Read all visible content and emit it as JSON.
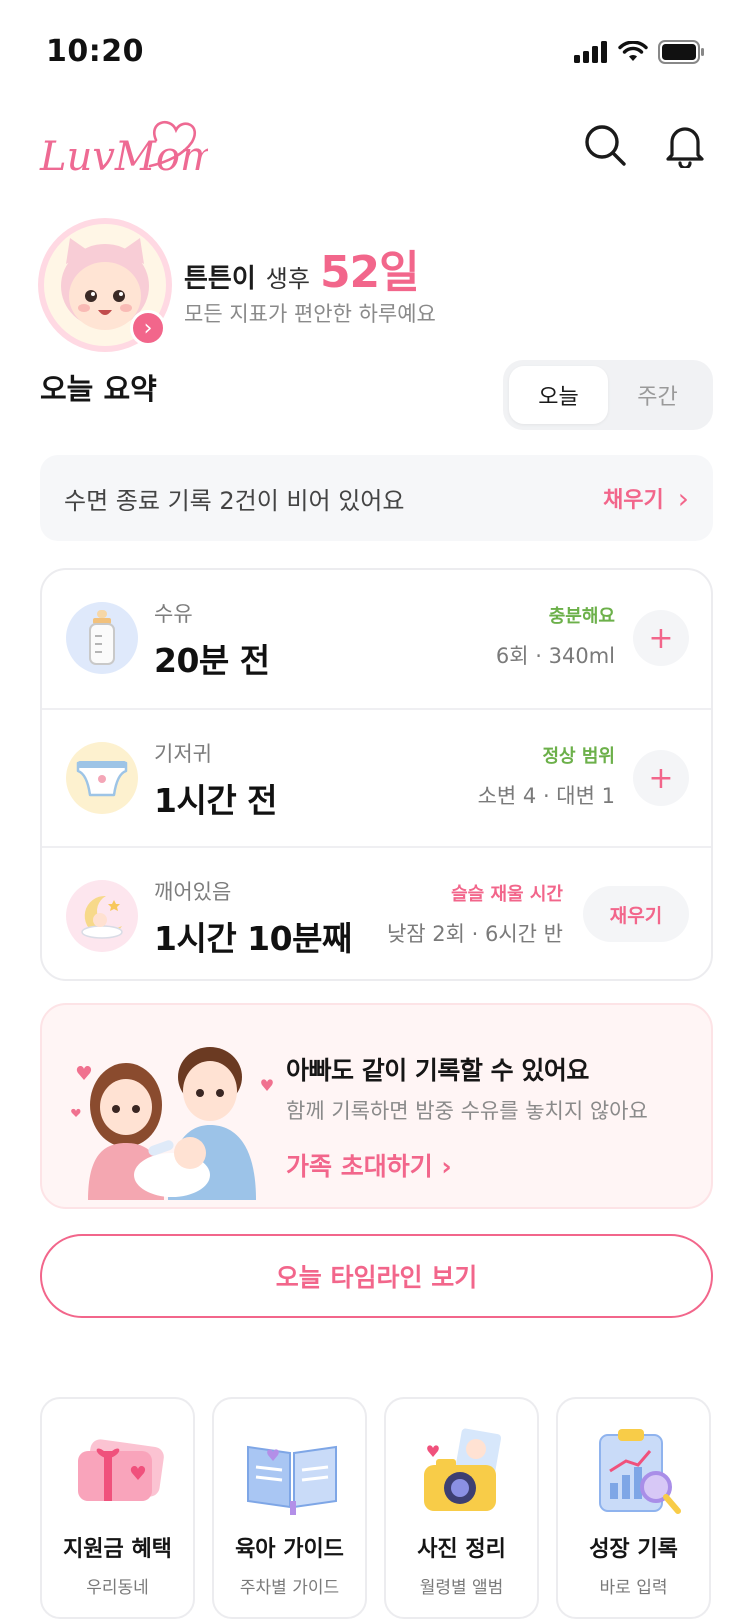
{
  "status_bar": {
    "time": "10:20"
  },
  "header": {
    "logo_text": "LuvMom"
  },
  "profile": {
    "baby_name": "튼튼이",
    "age_prefix": "생후",
    "age_days": "52일",
    "status_message": "모든 지표가 편안한 하루예요"
  },
  "summary": {
    "title": "오늘 요약",
    "tabs": [
      {
        "label": "오늘",
        "selected": true
      },
      {
        "label": "주간",
        "selected": false
      }
    ]
  },
  "alert": {
    "message": "수면 종료 기록 2건이 비어 있어요",
    "action_label": "채우기",
    "action_arrow": "›"
  },
  "records": [
    {
      "label": "수유",
      "value": "20분 전",
      "status": "충분해요",
      "detail": "6회 · 340ml",
      "button": "+",
      "icon": "baby-bottle-icon"
    },
    {
      "label": "기저귀",
      "value": "1시간 전",
      "status": "정상 범위",
      "detail": "소변 4 · 대변 1",
      "button": "+",
      "icon": "diaper-icon"
    },
    {
      "label": "깨어있음",
      "value": "1시간 10분째",
      "status": "슬슬 재울 시간",
      "detail": "낮잠 2회 · 6시간 반",
      "button": "재우기",
      "icon": "sleeping-baby-moon-icon"
    }
  ],
  "invite": {
    "title": "아빠도 같이 기록할 수 있어요",
    "description": "함께 기록하면 밤중 수유를 놓치지 않아요",
    "cta": "가족 초대하기 ›"
  },
  "timeline_button": "오늘 타임라인 보기",
  "quick_menu": [
    {
      "title": "지원금 혜택",
      "subtitle": "우리동네",
      "icon": "gift-ticket-icon"
    },
    {
      "title": "육아 가이드",
      "subtitle": "주차별 가이드",
      "icon": "open-book-icon"
    },
    {
      "title": "사진 정리",
      "subtitle": "월령별 앨범",
      "icon": "camera-photo-icon"
    },
    {
      "title": "성장 기록",
      "subtitle": "바로 입력",
      "icon": "growth-chart-clipboard-icon"
    }
  ],
  "colors": {
    "brand_pink": "#f2668b",
    "ok_green": "#6cb04a",
    "card_border": "#ececef",
    "alert_bg": "#f6f7f9",
    "invite_bg": "#fff5f5"
  }
}
